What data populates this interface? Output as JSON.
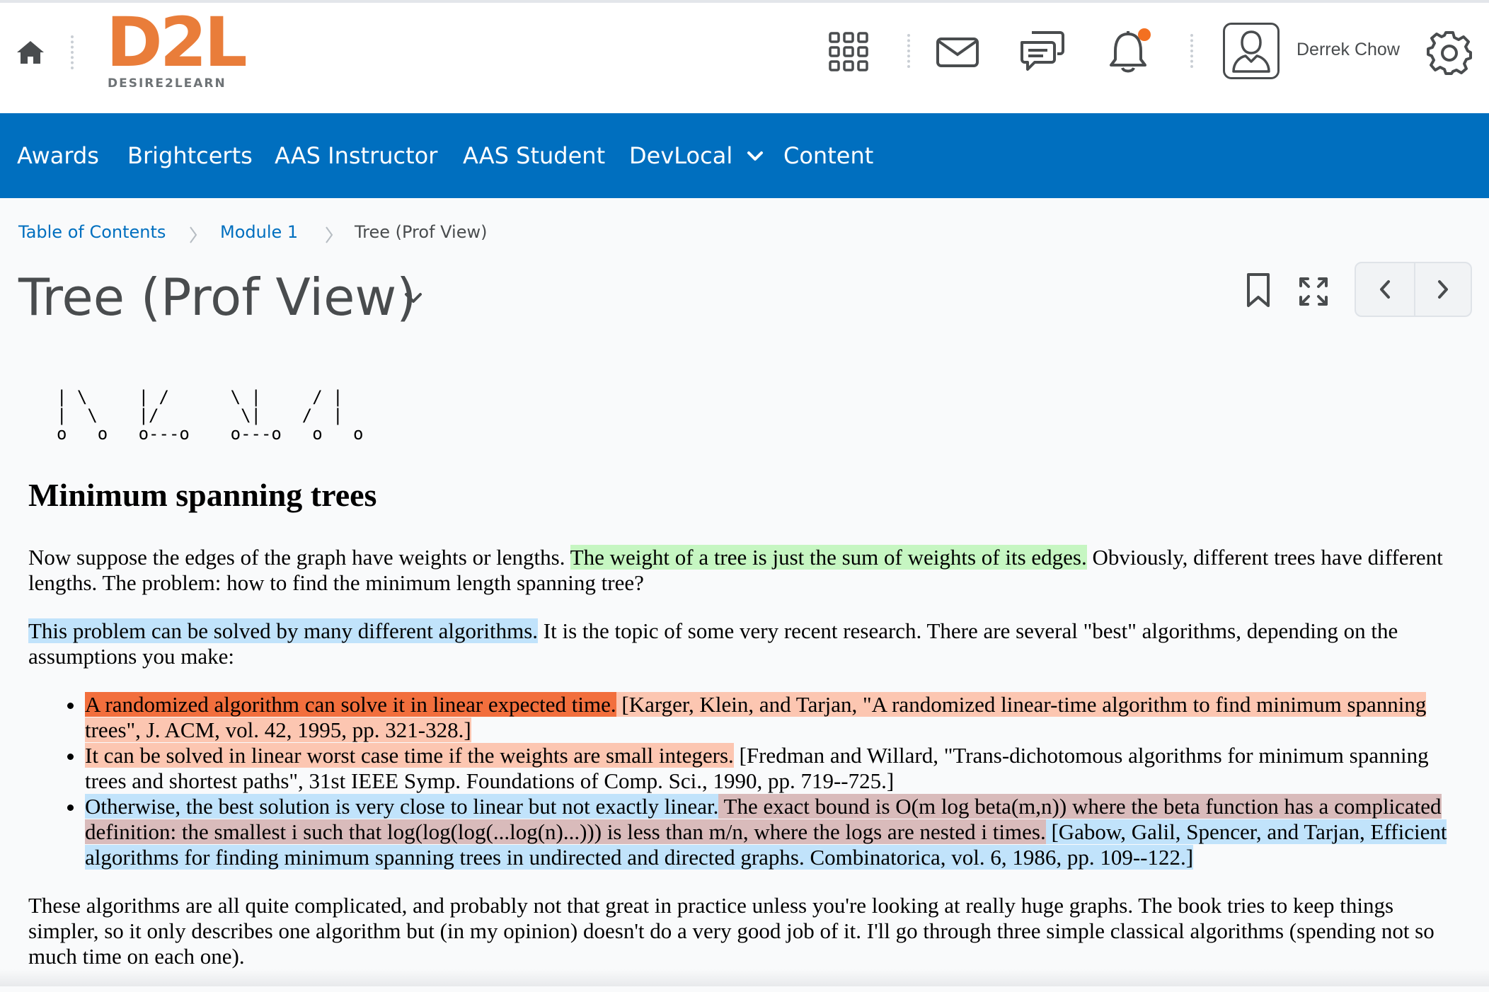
{
  "header": {
    "logo_main": "D2L",
    "logo_sub": "DESIRE2LEARN",
    "username": "Derrek Chow",
    "icons": [
      "home-icon",
      "apps-grid-icon",
      "mail-icon",
      "chat-icon",
      "bell-icon",
      "user-avatar-icon",
      "gear-icon"
    ],
    "notification_dot_color": "#f37021"
  },
  "nav": {
    "items": [
      "Awards",
      "Brightcerts",
      "AAS Instructor",
      "AAS Student",
      "DevLocal",
      "Content"
    ],
    "bar_color": "#006fbf"
  },
  "breadcrumb": {
    "items": [
      "Table of Contents",
      "Module 1"
    ],
    "current": "Tree (Prof View)"
  },
  "page": {
    "title": "Tree (Prof View)"
  },
  "content": {
    "ascii_art": "| \\     | /      \\ |     / |\n|  \\    |/        \\|    /  |\no   o   o---o    o---o   o   o",
    "heading": "Minimum spanning trees",
    "p1": {
      "a": "Now suppose the edges of the graph have weights or lengths. ",
      "hl": "The weight of a tree is just the sum of weights of its edges.",
      "b": " Obviously, different trees have different lengths. The problem: how to find the minimum length spanning tree?"
    },
    "p2": {
      "hl": "This problem can be solved by many different algorithms.",
      "b": " It is the topic of some very recent research. There are several \"best\" algorithms, depending on the assumptions you make:"
    },
    "bullets": [
      {
        "hl1": "A randomized algorithm can solve it in linear expected time.",
        "hl2": " [Karger, Klein, and Tarjan, \"A randomized linear-time algorithm to find minimum spanning trees\", J. ACM, vol. 42, 1995, pp. 321-328.]"
      },
      {
        "hl1": "It can be solved in linear worst case time if the weights are small integers.",
        "b": " [Fredman and Willard, \"Trans-dichotomous algorithms for minimum spanning trees and shortest paths\", 31st IEEE Symp. Foundations of Comp. Sci., 1990, pp. 719--725.]"
      },
      {
        "hl1": "Otherwise, the best solution is very close to linear but not exactly linear.",
        "hl2": " The exact bound is O(m log beta(m,n)) where the beta function has a complicated definition: the smallest i such that log(log(log(...log(n)...))) is less than m/n, where the logs are nested i times.",
        "hl3": " [Gabow, Galil, Spencer, and Tarjan, Efficient algorithms for finding minimum spanning trees in undirected and directed graphs. Combinatorica, vol. 6, 1986, pp. 109--122.]"
      }
    ],
    "p3": "These algorithms are all quite complicated, and probably not that great in practice unless you're looking at really huge graphs. The book tries to keep things simpler, so it only describes one algorithm but (in my opinion) doesn't do a very good job of it. I'll go through three simple classical algorithms (spending not so much time on each one).",
    "highlight_colors": {
      "green": "#c6f6c2",
      "blue": "#c1e3fb",
      "orange": "#f26f3d",
      "peach": "#fcc6b1",
      "mauve": "#d9bbbb"
    }
  }
}
